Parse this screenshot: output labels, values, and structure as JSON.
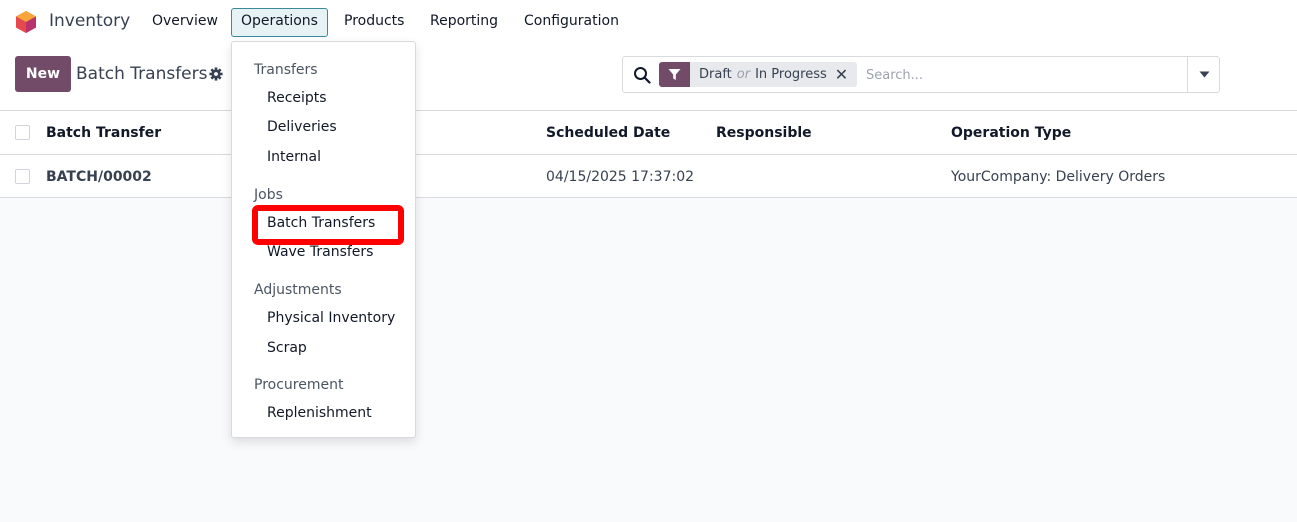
{
  "navbar": {
    "app_name": "Inventory",
    "menus": [
      "Overview",
      "Operations",
      "Products",
      "Reporting",
      "Configuration"
    ],
    "active_menu": "Operations"
  },
  "control_panel": {
    "new_label": "New",
    "title": "Batch Transfers",
    "search": {
      "facet_values": [
        "Draft",
        "In Progress"
      ],
      "facet_separator": "or",
      "placeholder": "Search..."
    }
  },
  "table": {
    "columns": [
      "Batch Transfer",
      "Scheduled Date",
      "Responsible",
      "Operation Type"
    ],
    "rows": [
      {
        "name": "BATCH/00002",
        "scheduled_date": "04/15/2025 17:37:02",
        "responsible": "",
        "operation_type": "YourCompany: Delivery Orders"
      }
    ]
  },
  "operations_menu": {
    "sections": [
      {
        "title": "Transfers",
        "items": [
          "Receipts",
          "Deliveries",
          "Internal"
        ]
      },
      {
        "title": "Jobs",
        "items": [
          "Batch Transfers",
          "Wave Transfers"
        ]
      },
      {
        "title": "Adjustments",
        "items": [
          "Physical Inventory",
          "Scrap"
        ]
      },
      {
        "title": "Procurement",
        "items": [
          "Replenishment"
        ]
      }
    ],
    "highlighted_item": "Batch Transfers"
  },
  "colors": {
    "brand": "#714b67",
    "highlight": "#ff0000",
    "active_menu_border": "#3a8a9a"
  }
}
